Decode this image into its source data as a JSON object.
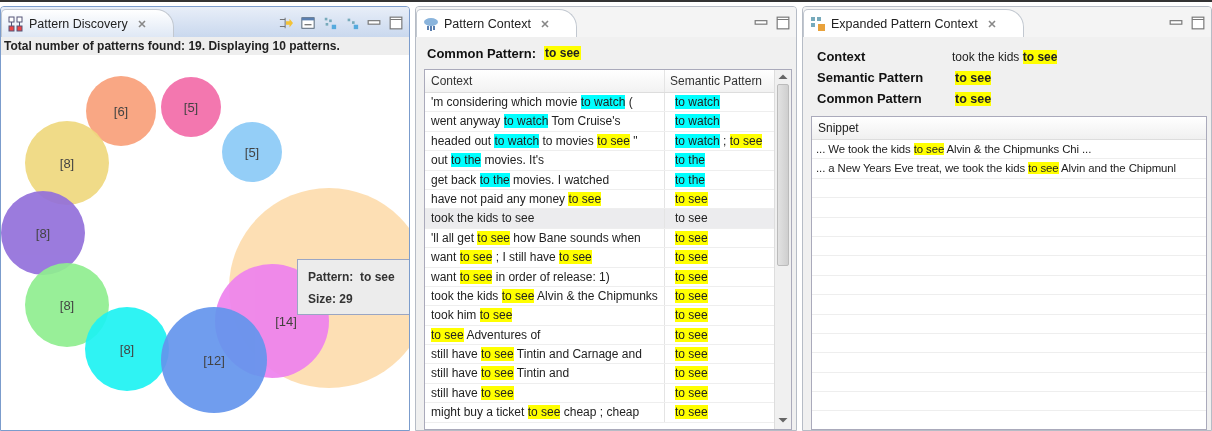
{
  "panels": [
    {
      "title": "Pattern Discovery",
      "active": true
    },
    {
      "title": "Pattern Context",
      "active": false
    },
    {
      "title": "Expanded Pattern Context",
      "active": false
    }
  ],
  "discovery": {
    "summary": "Total number of patterns found: 19. Displaying 10 patterns.",
    "bubbles": [
      {
        "color": "#fddcae"
      },
      {
        "label": "[6]",
        "color": "#f9a07a"
      },
      {
        "label": "[5]",
        "color": "#f36ca9"
      },
      {
        "label": "[5]",
        "color": "#8ccaf7"
      },
      {
        "label": "[8]",
        "color": "#efd87e"
      },
      {
        "label": "[8]",
        "color": "#9370db"
      },
      {
        "label": "[14]",
        "color": "#ee82ee"
      },
      {
        "label": "[8]",
        "color": "#90ee90"
      },
      {
        "label": "[8]",
        "color": "#1ef3f3"
      },
      {
        "label": "[12]",
        "color": "#6495ed"
      }
    ],
    "tooltip": {
      "pattern_label": "Pattern:",
      "pattern": "to see",
      "size": "Size: 29"
    }
  },
  "context": {
    "common_label": "Common Pattern:",
    "common": "to see",
    "columns": [
      "Context",
      "Semantic Pattern"
    ],
    "rows": [
      {
        "selected": false,
        "context": [
          {
            "text": "'m considering which movie "
          },
          {
            "text": "to watch",
            "color": "#00ffff"
          },
          {
            "text": " ("
          }
        ],
        "semantic": [
          {
            "text": "to watch",
            "color": "#00ffff"
          }
        ]
      },
      {
        "selected": false,
        "context": [
          {
            "text": "went anyway "
          },
          {
            "text": "to watch",
            "color": "#00ffff"
          },
          {
            "text": " Tom Cruise's"
          }
        ],
        "semantic": [
          {
            "text": "to watch",
            "color": "#00ffff"
          }
        ]
      },
      {
        "selected": false,
        "context": [
          {
            "text": "headed out "
          },
          {
            "text": "to watch",
            "color": "#00ffff"
          },
          {
            "text": " to movies "
          },
          {
            "text": "to see",
            "color": "#ffff00"
          },
          {
            "text": " \""
          }
        ],
        "semantic": [
          {
            "text": "to watch",
            "color": "#00ffff"
          },
          {
            "text": " ; "
          },
          {
            "text": "to see",
            "color": "#ffff00"
          }
        ]
      },
      {
        "selected": false,
        "context": [
          {
            "text": "out "
          },
          {
            "text": "to the",
            "color": "#00ffff"
          },
          {
            "text": " movies.  It's"
          }
        ],
        "semantic": [
          {
            "text": "to the",
            "color": "#00ffff"
          }
        ]
      },
      {
        "selected": false,
        "context": [
          {
            "text": "get back "
          },
          {
            "text": "to the",
            "color": "#00ffff"
          },
          {
            "text": " movies. I watched"
          }
        ],
        "semantic": [
          {
            "text": "to the",
            "color": "#00ffff"
          }
        ]
      },
      {
        "selected": false,
        "context": [
          {
            "text": "have not paid any money "
          },
          {
            "text": "to see",
            "color": "#ffff00"
          }
        ],
        "semantic": [
          {
            "text": "to see",
            "color": "#ffff00"
          }
        ]
      },
      {
        "selected": true,
        "context": [
          {
            "text": "took the kids to see"
          }
        ],
        "semantic": [
          {
            "text": "to see"
          }
        ]
      },
      {
        "selected": false,
        "context": [
          {
            "text": "'ll all get "
          },
          {
            "text": "to see",
            "color": "#ffff00"
          },
          {
            "text": " how Bane sounds when"
          }
        ],
        "semantic": [
          {
            "text": "to see",
            "color": "#ffff00"
          }
        ]
      },
      {
        "selected": false,
        "context": [
          {
            "text": "want "
          },
          {
            "text": "to see",
            "color": "#ffff00"
          },
          {
            "text": " ; I still have "
          },
          {
            "text": "to see",
            "color": "#ffff00"
          }
        ],
        "semantic": [
          {
            "text": "to see",
            "color": "#ffff00"
          }
        ]
      },
      {
        "selected": false,
        "context": [
          {
            "text": "want "
          },
          {
            "text": "to see",
            "color": "#ffff00"
          },
          {
            "text": " in order of release: 1)"
          }
        ],
        "semantic": [
          {
            "text": "to see",
            "color": "#ffff00"
          }
        ]
      },
      {
        "selected": false,
        "context": [
          {
            "text": "took the kids "
          },
          {
            "text": "to see",
            "color": "#ffff00"
          },
          {
            "text": " Alvin & the Chipmunks"
          }
        ],
        "semantic": [
          {
            "text": "to see",
            "color": "#ffff00"
          }
        ]
      },
      {
        "selected": false,
        "context": [
          {
            "text": "took him "
          },
          {
            "text": "to see",
            "color": "#ffff00"
          }
        ],
        "semantic": [
          {
            "text": "to see",
            "color": "#ffff00"
          }
        ]
      },
      {
        "selected": false,
        "context": [
          {
            "text": "to see",
            "color": "#ffff00"
          },
          {
            "text": " Adventures of"
          }
        ],
        "semantic": [
          {
            "text": "to see",
            "color": "#ffff00"
          }
        ]
      },
      {
        "selected": false,
        "context": [
          {
            "text": "still have "
          },
          {
            "text": "to see",
            "color": "#ffff00"
          },
          {
            "text": " Tintin and Carnage and"
          }
        ],
        "semantic": [
          {
            "text": "to see",
            "color": "#ffff00"
          }
        ]
      },
      {
        "selected": false,
        "context": [
          {
            "text": "still have "
          },
          {
            "text": "to see",
            "color": "#ffff00"
          },
          {
            "text": " Tintin and"
          }
        ],
        "semantic": [
          {
            "text": "to see",
            "color": "#ffff00"
          }
        ]
      },
      {
        "selected": false,
        "context": [
          {
            "text": "still have "
          },
          {
            "text": "to see",
            "color": "#ffff00"
          }
        ],
        "semantic": [
          {
            "text": "to see",
            "color": "#ffff00"
          }
        ]
      },
      {
        "selected": false,
        "context": [
          {
            "text": "might buy a ticket "
          },
          {
            "text": "to see",
            "color": "#ffff00"
          },
          {
            "text": " cheap ; cheap"
          }
        ],
        "semantic": [
          {
            "text": "to see",
            "color": "#ffff00"
          }
        ]
      }
    ]
  },
  "expanded": {
    "fields": [
      {
        "label": "Context",
        "value": [
          {
            "text": "took the kids "
          },
          {
            "text": "to see",
            "color": "#ffff00"
          }
        ]
      },
      {
        "label": "Semantic Pattern",
        "value": [
          {
            "text": "to see",
            "color": "#ffff00"
          }
        ]
      },
      {
        "label": "Common Pattern",
        "value": [
          {
            "text": "to see",
            "color": "#ffff00"
          }
        ]
      }
    ],
    "snippet_column": "Snippet",
    "snippets": [
      [
        {
          "text": "... We took the kids "
        },
        {
          "text": "to see",
          "color": "#ffff00"
        },
        {
          "text": " Alvin & the Chipmunks Chi ..."
        }
      ],
      [
        {
          "text": "... a New Years Eve treat, we took the kids "
        },
        {
          "text": "to see",
          "color": "#ffff00"
        },
        {
          "text": " Alvin and the Chipmunl"
        }
      ]
    ]
  }
}
